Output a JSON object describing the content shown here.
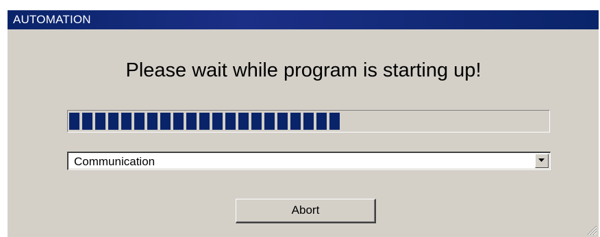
{
  "window": {
    "title": "AUTOMATION"
  },
  "message": {
    "text": "Please wait while program is starting up!"
  },
  "progress": {
    "fraction": 0.57,
    "fill_color": "#0a246a"
  },
  "dropdown": {
    "selected_value": "Communication",
    "arrow_icon": "chevron-down-icon"
  },
  "buttons": {
    "abort_label": "Abort"
  },
  "colors": {
    "title_bar": "#0a246a",
    "dialog_face": "#d4d0c8"
  }
}
